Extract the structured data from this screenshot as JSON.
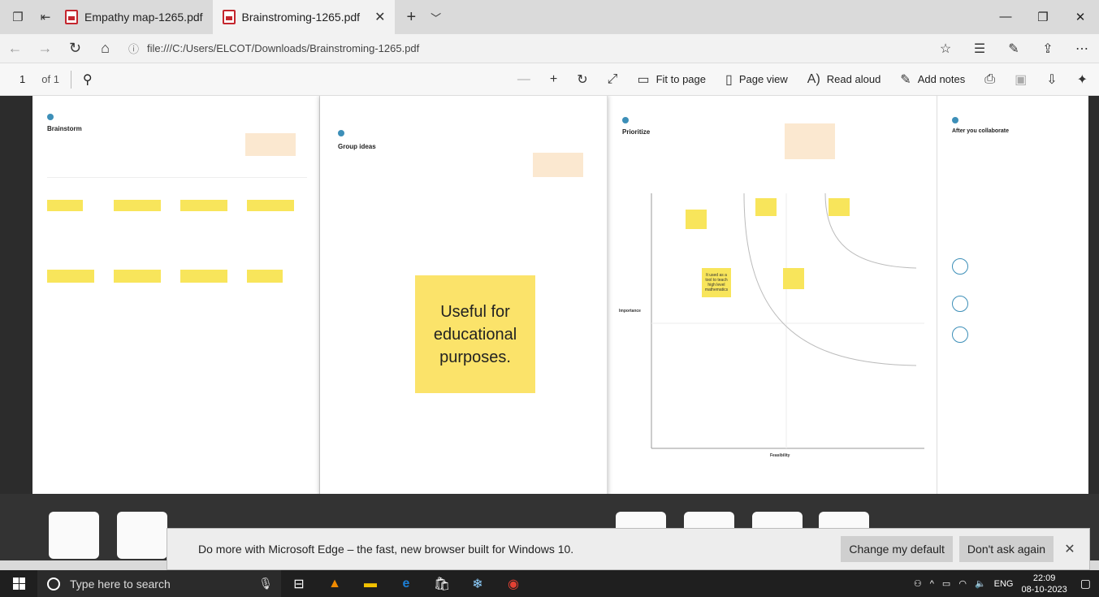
{
  "tabs": [
    {
      "label": "Empathy map-1265.pdf",
      "active": false
    },
    {
      "label": "Brainstroming-1265.pdf",
      "active": true
    }
  ],
  "address": {
    "url": "file:///C:/Users/ELCOT/Downloads/Brainstroming-1265.pdf"
  },
  "pdf_toolbar": {
    "page_number": "1",
    "page_of": "of 1",
    "fit_to_page": "Fit to page",
    "page_view": "Page view",
    "read_aloud": "Read aloud",
    "add_notes": "Add notes"
  },
  "board": {
    "brainstorm_title": "Brainstorm",
    "group_ideas_title": "Group ideas",
    "prioritize_title": "Prioritize",
    "after_collab_title": "After you collaborate",
    "importance_label": "Importance",
    "feasibility_label": "Feasibility",
    "sticky_note": "Useful for educational purposes.",
    "sticky_used_as_tool": "It used as a tool to teach high level mathematics"
  },
  "banner": {
    "message": "Do more with Microsoft Edge – the fast, new browser built for Windows 10.",
    "change_default": "Change my default",
    "dont_ask": "Don't ask again"
  },
  "taskbar": {
    "search_placeholder": "Type here to search",
    "language": "ENG",
    "time": "22:09",
    "date": "08-10-2023"
  },
  "colors": {
    "sticky": "#f8e55b",
    "accent": "#3d8fb8",
    "pdf_red": "#c4262e"
  }
}
